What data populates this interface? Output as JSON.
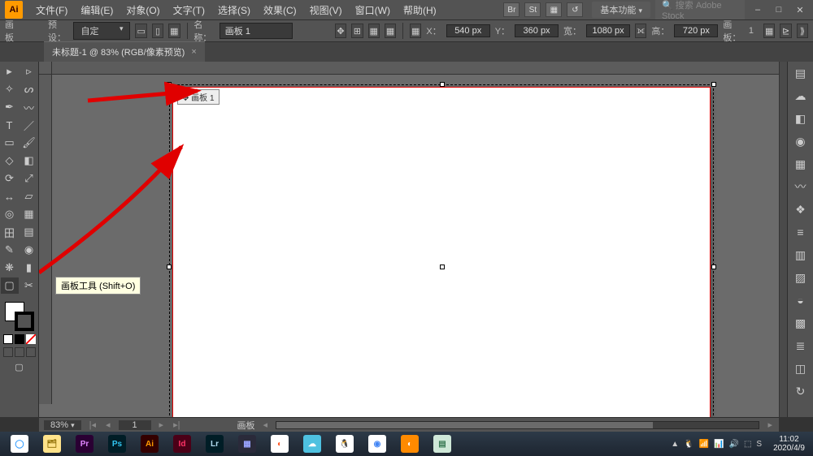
{
  "app_logo": "Ai",
  "menus": [
    "文件(F)",
    "编辑(E)",
    "对象(O)",
    "文字(T)",
    "选择(S)",
    "效果(C)",
    "视图(V)",
    "窗口(W)",
    "帮助(H)"
  ],
  "menubar_right_icons": [
    "Br",
    "St",
    "▦",
    "↺"
  ],
  "workspace_label": "基本功能",
  "search_placeholder": "搜索 Adobe Stock",
  "window_buttons": [
    "–",
    "□",
    "✕"
  ],
  "options": {
    "tool_label": "画板",
    "preset_label": "预设：",
    "preset_value": "自定",
    "orient_icons": [
      "▭",
      "▯"
    ],
    "name_label": "名称：",
    "name_value": "画板 1",
    "coord": {
      "x_label": "X：",
      "x_value": "540 px",
      "y_label": "Y：",
      "y_value": "360 px",
      "w_label": "宽：",
      "w_value": "1080 px",
      "h_label": "高：",
      "h_value": "720 px"
    },
    "artboards_label": "画板：",
    "artboards_value": "1"
  },
  "doc_tab": {
    "title": "未标题-1 @ 83% (RGB/像素预览)",
    "close": "×"
  },
  "tooltip": "画板工具 (Shift+O)",
  "artboard_label": "画板 1",
  "tools": [
    {
      "n": "selection",
      "g": "▸"
    },
    {
      "n": "direct-select",
      "g": "▹"
    },
    {
      "n": "magic-wand",
      "g": "✧"
    },
    {
      "n": "lasso",
      "g": "ᔕ"
    },
    {
      "n": "pen",
      "g": "✒"
    },
    {
      "n": "curvature",
      "g": "〰"
    },
    {
      "n": "type",
      "g": "T"
    },
    {
      "n": "line",
      "g": "／"
    },
    {
      "n": "rectangle",
      "g": "▭"
    },
    {
      "n": "paintbrush",
      "g": "🖌"
    },
    {
      "n": "shaper",
      "g": "◇"
    },
    {
      "n": "eraser",
      "g": "◧"
    },
    {
      "n": "rotate",
      "g": "⟳"
    },
    {
      "n": "scale",
      "g": "⤢"
    },
    {
      "n": "width",
      "g": "↔"
    },
    {
      "n": "free-transform",
      "g": "▱"
    },
    {
      "n": "shape-builder",
      "g": "◎"
    },
    {
      "n": "perspective",
      "g": "▦"
    },
    {
      "n": "mesh",
      "g": "田"
    },
    {
      "n": "gradient",
      "g": "▤"
    },
    {
      "n": "eyedropper",
      "g": "✎"
    },
    {
      "n": "blend",
      "g": "◉"
    },
    {
      "n": "symbol-sprayer",
      "g": "❋"
    },
    {
      "n": "column-graph",
      "g": "▮"
    },
    {
      "n": "artboard",
      "g": "▢",
      "sel": true
    },
    {
      "n": "slice",
      "g": "✂"
    }
  ],
  "right_panels": [
    {
      "n": "properties",
      "g": "▤"
    },
    {
      "n": "library",
      "g": "☁"
    },
    {
      "n": "layers",
      "g": "◧"
    },
    {
      "n": "color",
      "g": "◉"
    },
    {
      "n": "swatches",
      "g": "▦"
    },
    {
      "n": "brushes",
      "g": "〰"
    },
    {
      "n": "symbols",
      "g": "❖"
    },
    {
      "n": "stroke",
      "g": "≡"
    },
    {
      "n": "gradient",
      "g": "▥"
    },
    {
      "n": "transparency",
      "g": "▨"
    },
    {
      "n": "appearance",
      "g": "◒"
    },
    {
      "n": "graphic-styles",
      "g": "▩"
    },
    {
      "n": "align",
      "g": "≣"
    },
    {
      "n": "pathfinder",
      "g": "◫"
    },
    {
      "n": "transform",
      "g": "↻"
    }
  ],
  "status": {
    "zoom": "83%",
    "nav_page": "1",
    "canvas_label": "画板"
  },
  "taskbar_apps": [
    {
      "n": "browser",
      "bg": "#ffffff",
      "fg": "#3aa0ff",
      "t": "◯"
    },
    {
      "n": "explorer",
      "bg": "#ffe38a",
      "fg": "#8a6b00",
      "t": "🗂"
    },
    {
      "n": "premiere",
      "bg": "#2a0033",
      "fg": "#e085ff",
      "t": "Pr"
    },
    {
      "n": "photoshop",
      "bg": "#001d26",
      "fg": "#31c5f0",
      "t": "Ps"
    },
    {
      "n": "illustrator",
      "bg": "#330000",
      "fg": "#ff9a00",
      "t": "Ai"
    },
    {
      "n": "indesign",
      "bg": "#4b0017",
      "fg": "#ff3366",
      "t": "Id"
    },
    {
      "n": "lightroom",
      "bg": "#001d26",
      "fg": "#b4dcf0",
      "t": "Lr"
    },
    {
      "n": "media",
      "bg": "#2a2a3a",
      "fg": "#9aa4ff",
      "t": "▦"
    },
    {
      "n": "ball",
      "bg": "#ffffff",
      "fg": "#ff5522",
      "t": "◐"
    },
    {
      "n": "cloud",
      "bg": "#4ec1e0",
      "fg": "#fff",
      "t": "☁"
    },
    {
      "n": "qq",
      "bg": "#ffffff",
      "fg": "#000",
      "t": "🐧"
    },
    {
      "n": "chrome",
      "bg": "#ffffff",
      "fg": "#4285f4",
      "t": "◉"
    },
    {
      "n": "orange",
      "bg": "#ff8a00",
      "fg": "#fff",
      "t": "◐"
    },
    {
      "n": "notes",
      "bg": "#cfe8d8",
      "fg": "#3a7a55",
      "t": "▤"
    }
  ],
  "tray_icons": [
    "▲",
    "🐧",
    "📶",
    "📊",
    "🔊",
    "⬚",
    "S"
  ],
  "clock": {
    "time": "11:02",
    "date": "2020/4/9"
  }
}
